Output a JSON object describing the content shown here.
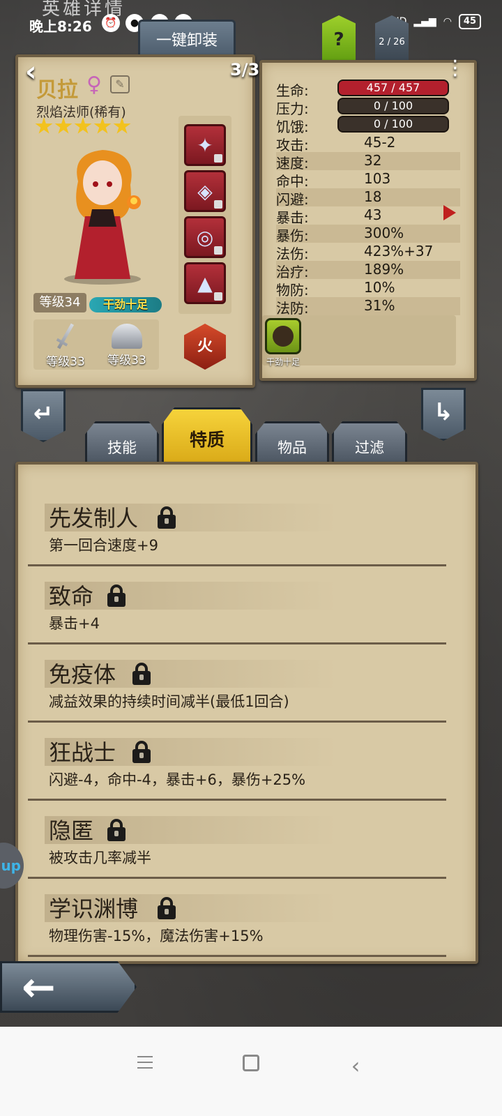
{
  "status_bar": {
    "time": "晚上8:26",
    "network": "HD",
    "battery": "45"
  },
  "header": {
    "page_title": "英雄详情",
    "unequip_all": "一键卸装",
    "help": "?",
    "roster_count": "2 / 26",
    "page_indicator": "3/3"
  },
  "hero": {
    "name": "贝拉",
    "gender_symbol": "♀",
    "class": "烈焰法师(稀有)",
    "stars": 5,
    "level": "等级34",
    "status_chip": "干劲十足",
    "weapon_level": "等级33",
    "armor_level": "等级33",
    "element": "火"
  },
  "stats": {
    "hp": {
      "label": "生命:",
      "value": "457 / 457"
    },
    "stress": {
      "label": "压力:",
      "value": "0 / 100"
    },
    "hunger": {
      "label": "饥饿:",
      "value": "0 / 100"
    },
    "rows": [
      {
        "label": "攻击:",
        "value": "45-2"
      },
      {
        "label": "速度:",
        "value": "32"
      },
      {
        "label": "命中:",
        "value": "103"
      },
      {
        "label": "闪避:",
        "value": "18"
      },
      {
        "label": "暴击:",
        "value": "43"
      },
      {
        "label": "暴伤:",
        "value": "300%"
      },
      {
        "label": "法伤:",
        "value": "423%+37"
      },
      {
        "label": "治疗:",
        "value": "189%"
      },
      {
        "label": "物防:",
        "value": "10%"
      },
      {
        "label": "法防:",
        "value": "31%"
      }
    ],
    "trait_icon_label": "干劲十足"
  },
  "tabs": [
    "技能",
    "特质",
    "物品",
    "过滤"
  ],
  "active_tab": "特质",
  "traits": [
    {
      "name": "先发制人",
      "desc": "第一回合速度+9"
    },
    {
      "name": "致命",
      "desc": "暴击+4"
    },
    {
      "name": "免疫体",
      "desc": "减益效果的持续时间减半(最低1回合)"
    },
    {
      "name": "狂战士",
      "desc": "闪避-4，命中-4，暴击+6，暴伤+25%"
    },
    {
      "name": "隐匿",
      "desc": "被攻击几率减半"
    },
    {
      "name": "学识渊博",
      "desc": "物理伤害-15%，魔法伤害+15%"
    }
  ],
  "side_tab_text": "up",
  "colors": {
    "hp_bar": "#b3202d",
    "active_tab": "#f2c21e",
    "parchment": "#d8c9a5"
  }
}
